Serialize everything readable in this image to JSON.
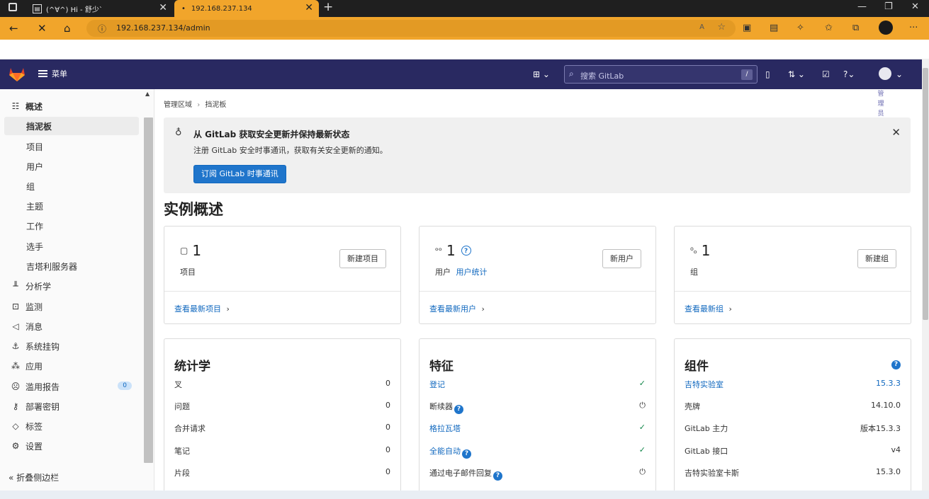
{
  "browser": {
    "tab1_title": "(^∀^) Hi - 舒少`",
    "tab2_title": "192.168.237.134",
    "new_tab": "+",
    "address": "192.168.237.134/admin"
  },
  "header": {
    "menu_label": "菜单",
    "search_placeholder": "搜索 GitLab",
    "search_shortcut": "/"
  },
  "sidebar": {
    "overview": "概述",
    "sub_items": [
      "挡泥板",
      "项目",
      "用户",
      "组",
      "主题",
      "工作",
      "选手",
      "吉塔利服务器"
    ],
    "items": [
      {
        "label": "分析学",
        "icon": "chart-icon"
      },
      {
        "label": "监测",
        "icon": "monitor-icon"
      },
      {
        "label": "消息",
        "icon": "megaphone-icon"
      },
      {
        "label": "系统挂钩",
        "icon": "anchor-icon"
      },
      {
        "label": "应用",
        "icon": "apps-icon"
      },
      {
        "label": "滥用报告",
        "icon": "abuse-icon",
        "badge": "0"
      },
      {
        "label": "部署密钥",
        "icon": "key-icon"
      },
      {
        "label": "标签",
        "icon": "label-icon"
      },
      {
        "label": "设置",
        "icon": "gear-icon"
      }
    ],
    "collapse": "折叠侧边栏"
  },
  "main": {
    "breadcrumb": [
      "管理区域",
      "挡泥板"
    ],
    "user_vertical": "管理员",
    "alert": {
      "title": "从 GitLab 获取安全更新并保持最新状态",
      "body": "注册 GitLab 安全时事通讯，获取有关安全更新的通知。",
      "button": "订阅 GitLab 时事通讯"
    },
    "title": "实例概述",
    "cards": [
      {
        "num": "1",
        "label": "项目",
        "link_label": "",
        "button": "新建项目",
        "more": "查看最新项目"
      },
      {
        "num": "1",
        "label": "用户",
        "link_label": "用户统计",
        "button": "新用户",
        "more": "查看最新用户"
      },
      {
        "num": "1",
        "label": "组",
        "link_label": "",
        "button": "新建组",
        "more": "查看最新组"
      }
    ],
    "stats": {
      "title": "统计学",
      "rows": [
        {
          "k": "叉",
          "v": "0"
        },
        {
          "k": "问题",
          "v": "0"
        },
        {
          "k": "合并请求",
          "v": "0"
        },
        {
          "k": "笔记",
          "v": "0"
        },
        {
          "k": "片段",
          "v": "0"
        }
      ]
    },
    "features": {
      "title": "特征",
      "rows": [
        {
          "k": "登记",
          "state": "enabled"
        },
        {
          "k": "断续器",
          "state": "off"
        },
        {
          "k": "格拉瓦塔",
          "state": "enabled"
        },
        {
          "k": "全能自动",
          "state": "enabled"
        },
        {
          "k": "通过电子邮件回复",
          "state": "off"
        }
      ]
    },
    "components": {
      "title": "组件",
      "rows": [
        {
          "k": "吉特实验室",
          "v": "15.3.3"
        },
        {
          "k": "壳牌",
          "v": "14.10.0"
        },
        {
          "k": "GitLab 主力",
          "v": "版本15.3.3"
        },
        {
          "k": "GitLab 接口",
          "v": "v4"
        },
        {
          "k": "吉特实验室卡斯",
          "v": "15.3.0"
        }
      ]
    }
  }
}
